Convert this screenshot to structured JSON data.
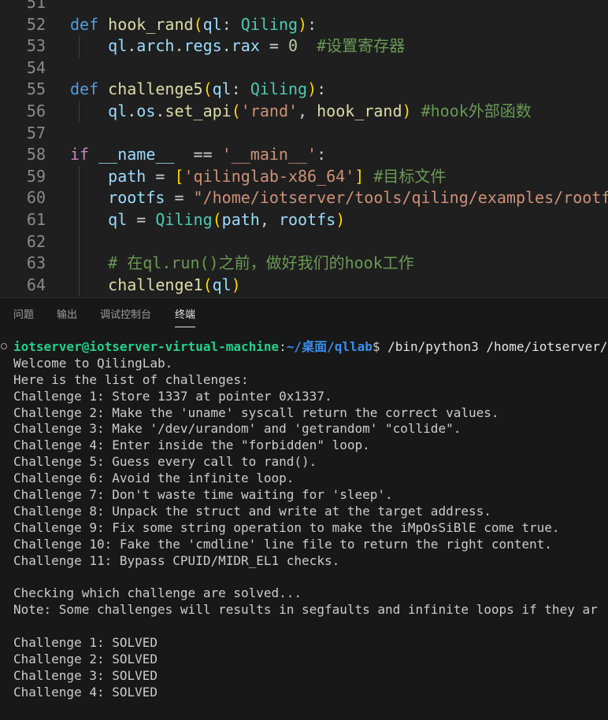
{
  "editor": {
    "lines": [
      {
        "num": "51",
        "segments": []
      },
      {
        "num": "52",
        "segments": [
          {
            "t": "def",
            "c": "kw"
          },
          {
            "t": " ",
            "c": "plain"
          },
          {
            "t": "hook_rand",
            "c": "fn"
          },
          {
            "t": "(",
            "c": "br1"
          },
          {
            "t": "ql",
            "c": "param"
          },
          {
            "t": ": ",
            "c": "plain"
          },
          {
            "t": "Qiling",
            "c": "cls"
          },
          {
            "t": ")",
            "c": "br1"
          },
          {
            "t": ":",
            "c": "plain"
          }
        ]
      },
      {
        "num": "53",
        "guide": true,
        "segments": [
          {
            "t": "    ql",
            "c": "param"
          },
          {
            "t": ".",
            "c": "plain"
          },
          {
            "t": "arch",
            "c": "param"
          },
          {
            "t": ".",
            "c": "plain"
          },
          {
            "t": "regs",
            "c": "param"
          },
          {
            "t": ".",
            "c": "plain"
          },
          {
            "t": "rax",
            "c": "param"
          },
          {
            "t": " = ",
            "c": "plain"
          },
          {
            "t": "0",
            "c": "num"
          },
          {
            "t": "  #设置寄存器",
            "c": "cmt"
          }
        ]
      },
      {
        "num": "54",
        "segments": []
      },
      {
        "num": "55",
        "segments": [
          {
            "t": "def",
            "c": "kw"
          },
          {
            "t": " ",
            "c": "plain"
          },
          {
            "t": "challenge5",
            "c": "fn"
          },
          {
            "t": "(",
            "c": "br1"
          },
          {
            "t": "ql",
            "c": "param"
          },
          {
            "t": ": ",
            "c": "plain"
          },
          {
            "t": "Qiling",
            "c": "cls"
          },
          {
            "t": ")",
            "c": "br1"
          },
          {
            "t": ":",
            "c": "plain"
          }
        ]
      },
      {
        "num": "56",
        "guide": true,
        "segments": [
          {
            "t": "    ql",
            "c": "param"
          },
          {
            "t": ".",
            "c": "plain"
          },
          {
            "t": "os",
            "c": "param"
          },
          {
            "t": ".",
            "c": "plain"
          },
          {
            "t": "set_api",
            "c": "fn"
          },
          {
            "t": "(",
            "c": "br1"
          },
          {
            "t": "'rand'",
            "c": "str"
          },
          {
            "t": ", ",
            "c": "plain"
          },
          {
            "t": "hook_rand",
            "c": "fn"
          },
          {
            "t": ")",
            "c": "br1"
          },
          {
            "t": " #hook外部函数",
            "c": "cmt"
          }
        ]
      },
      {
        "num": "57",
        "segments": []
      },
      {
        "num": "58",
        "segments": [
          {
            "t": "if",
            "c": "kw2"
          },
          {
            "t": " ",
            "c": "plain"
          },
          {
            "t": "__name__",
            "c": "param"
          },
          {
            "t": "  == ",
            "c": "plain"
          },
          {
            "t": "'__main__'",
            "c": "str"
          },
          {
            "t": ":",
            "c": "plain"
          }
        ]
      },
      {
        "num": "59",
        "guide": true,
        "segments": [
          {
            "t": "    path",
            "c": "param"
          },
          {
            "t": " = ",
            "c": "plain"
          },
          {
            "t": "[",
            "c": "br1"
          },
          {
            "t": "'qilinglab-x86_64'",
            "c": "str"
          },
          {
            "t": "]",
            "c": "br1"
          },
          {
            "t": " #目标文件",
            "c": "cmt"
          }
        ]
      },
      {
        "num": "60",
        "guide": true,
        "segments": [
          {
            "t": "    rootfs",
            "c": "param"
          },
          {
            "t": " = ",
            "c": "plain"
          },
          {
            "t": "\"/home/iotserver/tools/qiling/examples/rootfs",
            "c": "str"
          }
        ]
      },
      {
        "num": "61",
        "guide": true,
        "segments": [
          {
            "t": "    ql",
            "c": "param"
          },
          {
            "t": " = ",
            "c": "plain"
          },
          {
            "t": "Qiling",
            "c": "cls"
          },
          {
            "t": "(",
            "c": "br1"
          },
          {
            "t": "path",
            "c": "param"
          },
          {
            "t": ", ",
            "c": "plain"
          },
          {
            "t": "rootfs",
            "c": "param"
          },
          {
            "t": ")",
            "c": "br1"
          }
        ]
      },
      {
        "num": "62",
        "guide": true,
        "segments": []
      },
      {
        "num": "63",
        "guide": true,
        "segments": [
          {
            "t": "    # 在ql.run()之前，做好我们的hook工作",
            "c": "cmt"
          }
        ]
      },
      {
        "num": "64",
        "guide": true,
        "segments": [
          {
            "t": "    challenge1",
            "c": "fn"
          },
          {
            "t": "(",
            "c": "br1"
          },
          {
            "t": "ql",
            "c": "param"
          },
          {
            "t": ")",
            "c": "br1"
          }
        ]
      }
    ]
  },
  "panel": {
    "tabs": [
      {
        "label": "问题",
        "active": false
      },
      {
        "label": "输出",
        "active": false
      },
      {
        "label": "调试控制台",
        "active": false
      },
      {
        "label": "终端",
        "active": true
      }
    ]
  },
  "terminal": {
    "prompt": {
      "user": "iotserver@iotserver-virtual-machine",
      "sep": ":",
      "path": "~/桌面/qllab",
      "symbol": "$ ",
      "command": "/bin/python3 /home/iotserver/"
    },
    "lines": [
      "Welcome to QilingLab.",
      "Here is the list of challenges:",
      "Challenge 1: Store 1337 at pointer 0x1337.",
      "Challenge 2: Make the 'uname' syscall return the correct values.",
      "Challenge 3: Make '/dev/urandom' and 'getrandom' \"collide\".",
      "Challenge 4: Enter inside the \"forbidden\" loop.",
      "Challenge 5: Guess every call to rand().",
      "Challenge 6: Avoid the infinite loop.",
      "Challenge 7: Don't waste time waiting for 'sleep'.",
      "Challenge 8: Unpack the struct and write at the target address.",
      "Challenge 9: Fix some string operation to make the iMpOsSiBlE come true.",
      "Challenge 10: Fake the 'cmdline' line file to return the right content.",
      "Challenge 11: Bypass CPUID/MIDR_EL1 checks.",
      "",
      "Checking which challenge are solved...",
      "Note: Some challenges will results in segfaults and infinite loops if they ar",
      "",
      "Challenge 1: SOLVED",
      "Challenge 2: SOLVED",
      "Challenge 3: SOLVED",
      "Challenge 4: SOLVED"
    ]
  },
  "colors": {
    "editor_bg": "#1f1f1f",
    "panel_bg": "#181818",
    "prompt_user": "#23d18b",
    "prompt_path": "#3b8eea"
  }
}
